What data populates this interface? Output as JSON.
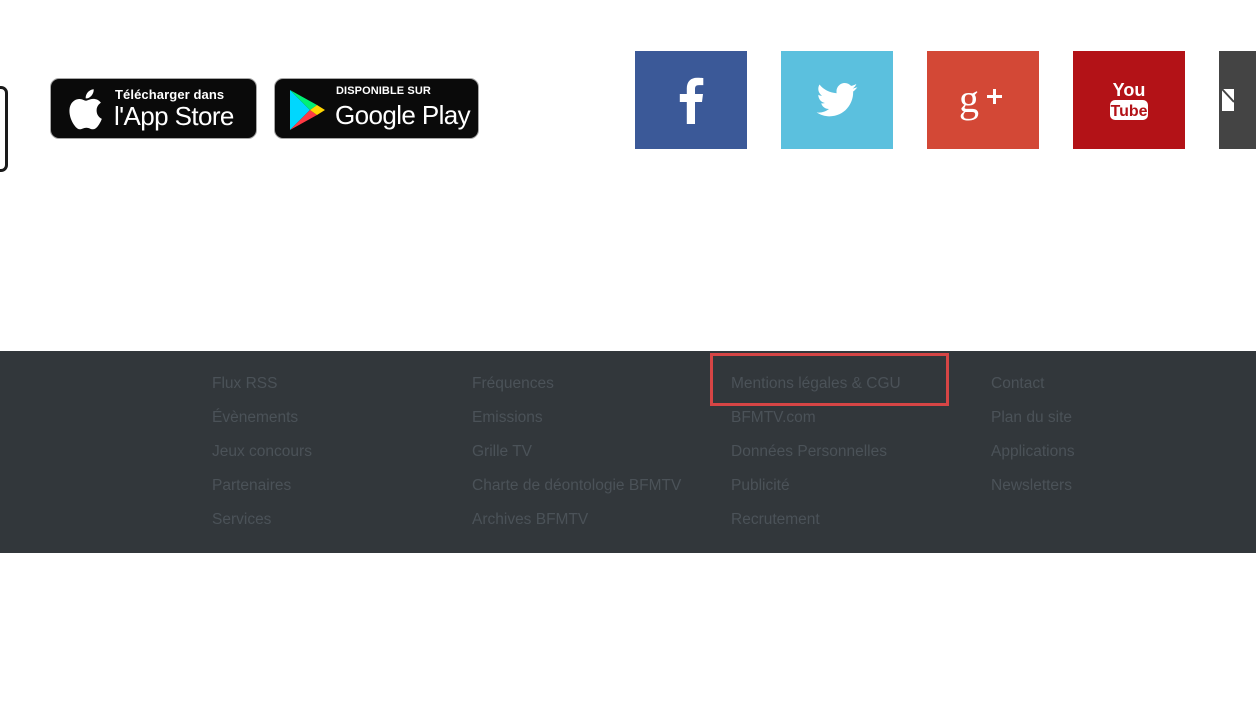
{
  "apps": {
    "app_store": {
      "small": "Télécharger dans",
      "big": "l'App Store"
    },
    "google_play": {
      "small": "DISPONIBLE SUR",
      "big": "Google Play"
    }
  },
  "social": [
    {
      "name": "facebook",
      "icon": "facebook-icon",
      "color": "#3b5998",
      "glyph": "f"
    },
    {
      "name": "twitter",
      "icon": "twitter-bird-icon",
      "color": "#5bc0de"
    },
    {
      "name": "google-plus",
      "icon": "google-plus-icon",
      "color": "#d34836",
      "glyph": "g+"
    },
    {
      "name": "youtube",
      "icon": "youtube-icon",
      "color": "#b31217",
      "glyph_top": "You",
      "glyph_bottom": "Tube"
    },
    {
      "name": "email",
      "icon": "envelope-icon",
      "color": "#444444"
    }
  ],
  "footer": {
    "background": "#32373b",
    "columns": [
      [
        "Flux RSS",
        "Évènements",
        "Jeux concours",
        "Partenaires",
        "Services"
      ],
      [
        "Fréquences",
        "Emissions",
        "Grille TV",
        "Charte de déontologie BFMTV",
        "Archives BFMTV"
      ],
      [
        "Mentions légales & CGU",
        "BFMTV.com",
        "Données Personnelles",
        "Publicité",
        "Recrutement"
      ],
      [
        "Contact",
        "Plan du site",
        "Applications",
        "Newsletters"
      ]
    ]
  },
  "highlight_color": "#d64545"
}
